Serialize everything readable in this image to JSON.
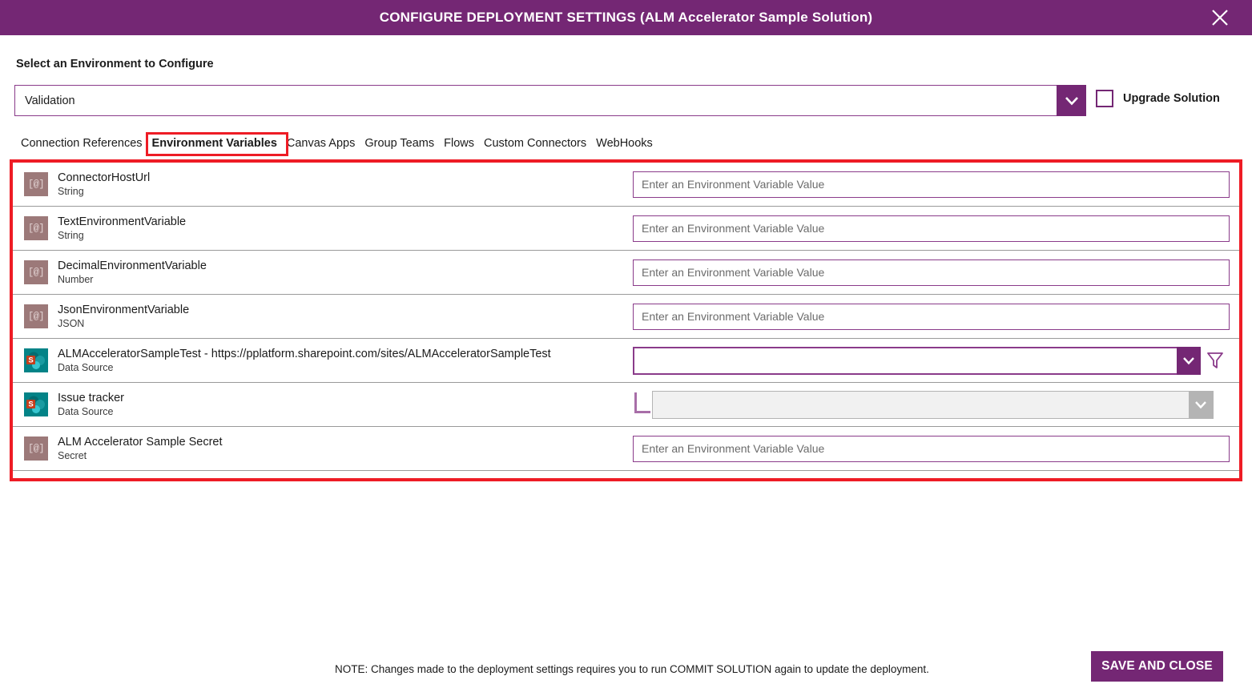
{
  "titlebar": {
    "title": "CONFIGURE DEPLOYMENT SETTINGS (ALM Accelerator Sample Solution)",
    "close_label": "✕"
  },
  "environment": {
    "label": "Select an Environment to Configure",
    "selected": "Validation",
    "upgrade_label": "Upgrade Solution",
    "upgrade_checked": false
  },
  "tabs": [
    {
      "label": "Connection References",
      "active": false
    },
    {
      "label": "Environment Variables",
      "active": true
    },
    {
      "label": "Canvas Apps",
      "active": false
    },
    {
      "label": "Group Teams",
      "active": false
    },
    {
      "label": "Flows",
      "active": false
    },
    {
      "label": "Custom Connectors",
      "active": false
    },
    {
      "label": "WebHooks",
      "active": false
    }
  ],
  "placeholders": {
    "env_var_value": "Enter an Environment Variable Value"
  },
  "rows": [
    {
      "icon": "environment-variable-icon",
      "title": "ConnectorHostUrl",
      "subtitle": "String",
      "control": "text",
      "value": "",
      "placeholder": "Enter an Environment Variable Value"
    },
    {
      "icon": "environment-variable-icon",
      "title": "TextEnvironmentVariable",
      "subtitle": "String",
      "control": "text",
      "value": "",
      "placeholder": "Enter an Environment Variable Value"
    },
    {
      "icon": "environment-variable-icon",
      "title": "DecimalEnvironmentVariable",
      "subtitle": "Number",
      "control": "text",
      "value": "",
      "placeholder": "Enter an Environment Variable Value"
    },
    {
      "icon": "environment-variable-icon",
      "title": "JsonEnvironmentVariable",
      "subtitle": "JSON",
      "control": "text",
      "value": "",
      "placeholder": "Enter an Environment Variable Value"
    },
    {
      "icon": "sharepoint-icon",
      "title": "ALMAcceleratorSampleTest - https://pplatform.sharepoint.com/sites/ALMAcceleratorSampleTest",
      "subtitle": "Data Source",
      "control": "dropdown",
      "value": "",
      "has_filter": true
    },
    {
      "icon": "sharepoint-icon",
      "title": "Issue tracker",
      "subtitle": "Data Source",
      "control": "dropdown-disabled",
      "value": "",
      "indented": true
    },
    {
      "icon": "environment-variable-icon",
      "title": "ALM Accelerator Sample Secret",
      "subtitle": "Secret",
      "control": "text",
      "value": "",
      "placeholder": "Enter an Environment Variable Value"
    }
  ],
  "footer": {
    "note": "NOTE: Changes made to the deployment settings requires you to run COMMIT SOLUTION again to update the deployment.",
    "save_label": "SAVE AND CLOSE"
  },
  "colors": {
    "brand_purple": "#742774",
    "annotation_red": "#ee1c25",
    "sharepoint_teal": "#038387",
    "env_icon_mauve": "#9c7979"
  }
}
